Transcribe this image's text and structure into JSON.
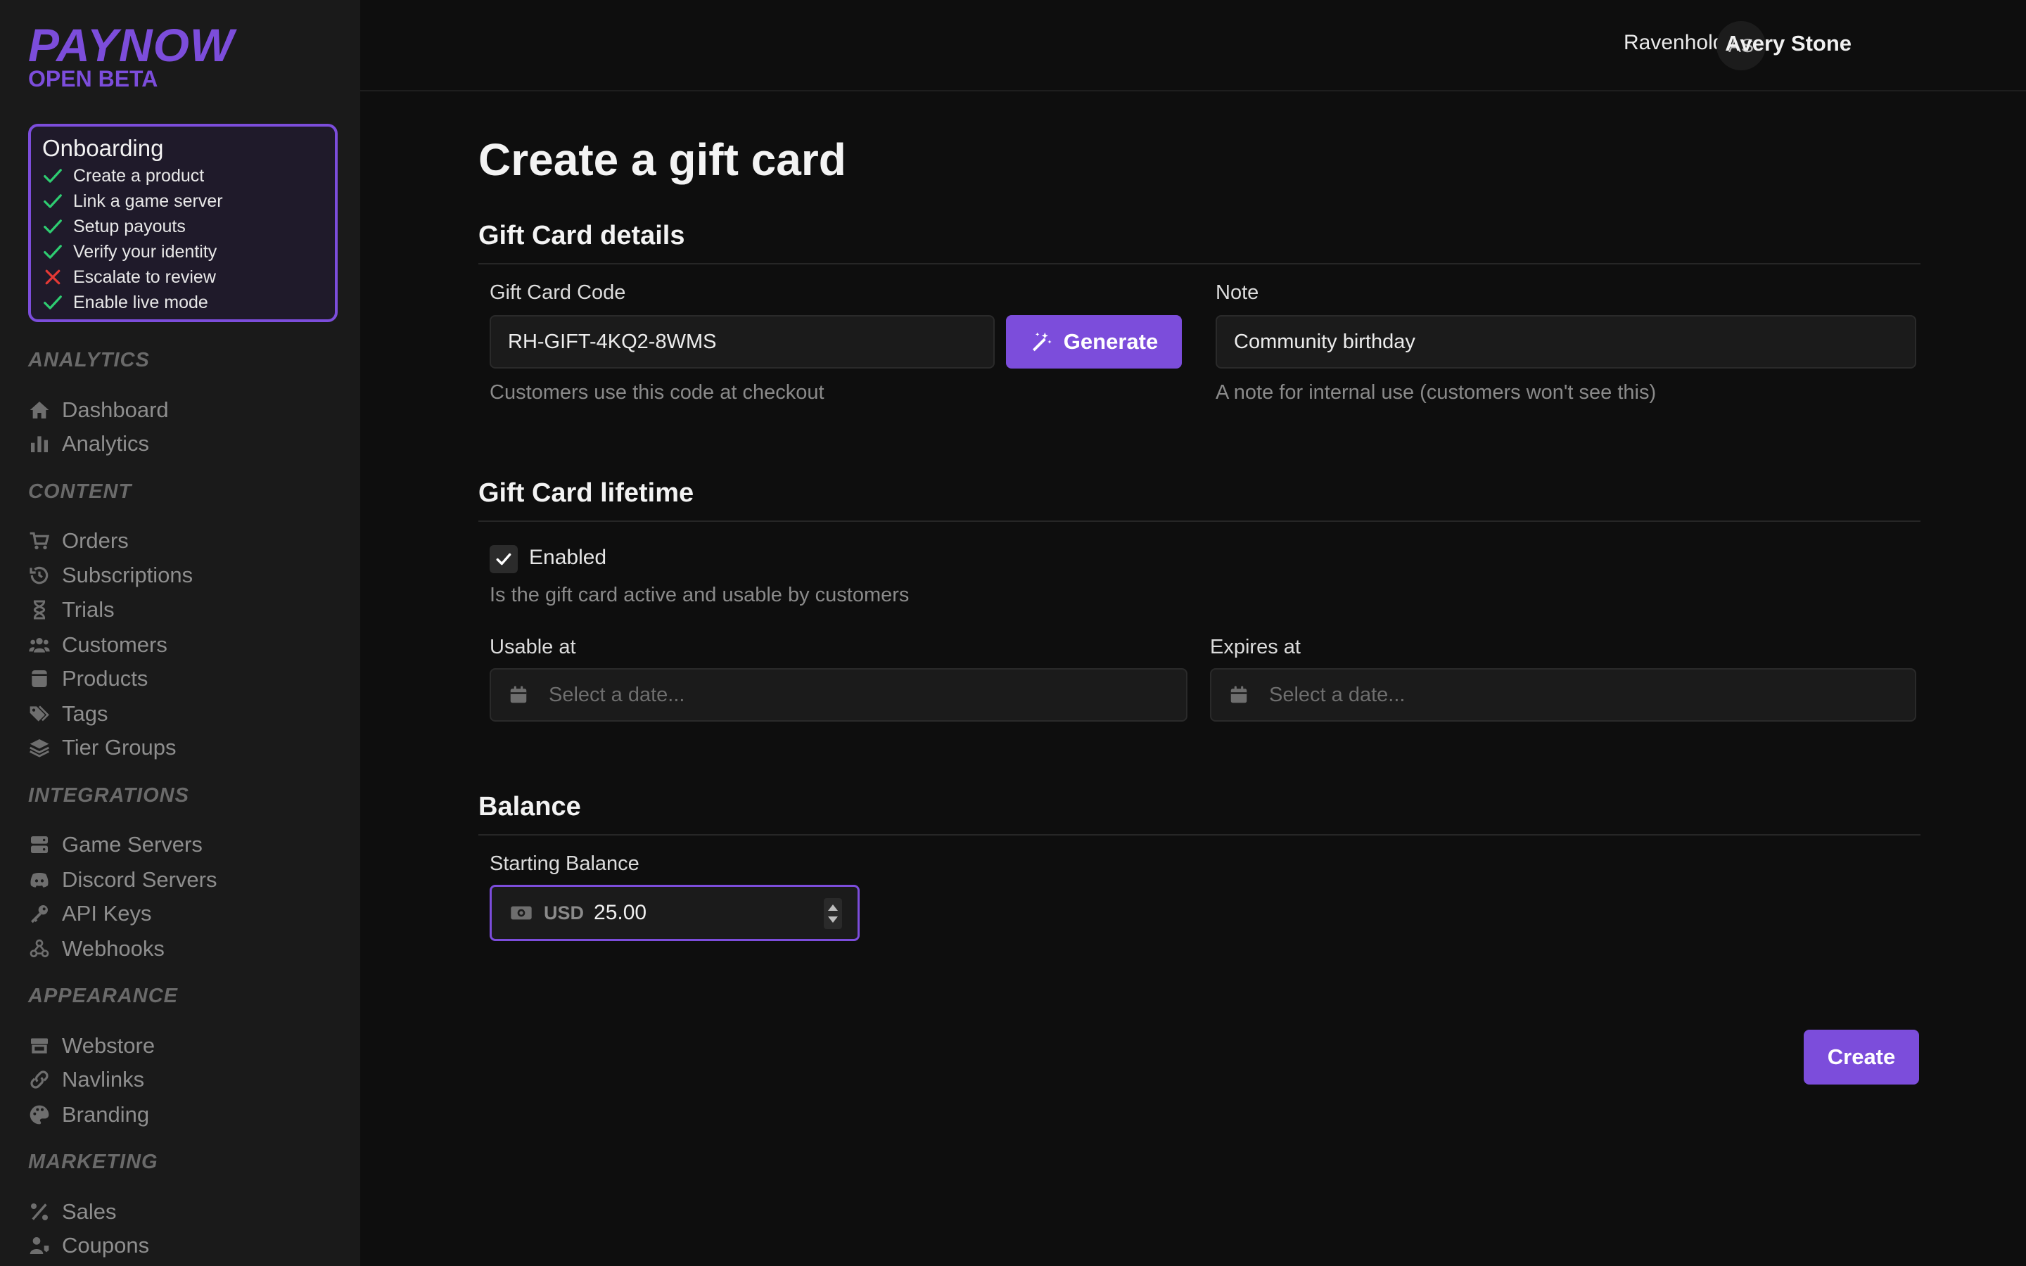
{
  "brand": {
    "title": "PAYNOW",
    "subtitle": "OPEN BETA"
  },
  "onboarding": {
    "title": "Onboarding",
    "items": [
      {
        "label": "Create a product",
        "status": "done"
      },
      {
        "label": "Link a game server",
        "status": "done"
      },
      {
        "label": "Setup payouts",
        "status": "done"
      },
      {
        "label": "Verify your identity",
        "status": "done"
      },
      {
        "label": "Escalate to review",
        "status": "failed"
      },
      {
        "label": "Enable live mode",
        "status": "done"
      }
    ]
  },
  "nav": {
    "analytics": {
      "title": "ANALYTICS",
      "items": [
        {
          "label": "Dashboard",
          "icon": "home-icon"
        },
        {
          "label": "Analytics",
          "icon": "bar-chart-icon"
        }
      ]
    },
    "content": {
      "title": "CONTENT",
      "items": [
        {
          "label": "Orders",
          "icon": "cart-icon"
        },
        {
          "label": "Subscriptions",
          "icon": "history-icon"
        },
        {
          "label": "Trials",
          "icon": "hourglass-icon"
        },
        {
          "label": "Customers",
          "icon": "users-icon"
        },
        {
          "label": "Products",
          "icon": "box-icon"
        },
        {
          "label": "Tags",
          "icon": "tags-icon"
        },
        {
          "label": "Tier Groups",
          "icon": "layers-icon"
        }
      ]
    },
    "integrations": {
      "title": "INTEGRATIONS",
      "items": [
        {
          "label": "Game Servers",
          "icon": "server-icon"
        },
        {
          "label": "Discord Servers",
          "icon": "discord-icon"
        },
        {
          "label": "API Keys",
          "icon": "key-icon"
        },
        {
          "label": "Webhooks",
          "icon": "webhook-icon"
        }
      ]
    },
    "appearance": {
      "title": "APPEARANCE",
      "items": [
        {
          "label": "Webstore",
          "icon": "store-icon"
        },
        {
          "label": "Navlinks",
          "icon": "link-icon"
        },
        {
          "label": "Branding",
          "icon": "palette-icon"
        }
      ]
    },
    "marketing": {
      "title": "MARKETING",
      "items": [
        {
          "label": "Sales",
          "icon": "percent-icon"
        },
        {
          "label": "Coupons",
          "icon": "user-tag-icon"
        }
      ]
    }
  },
  "header": {
    "store": "Ravenhold",
    "avatar_initials": "AS",
    "user_name": "Avery Stone"
  },
  "page": {
    "title": "Create a gift card",
    "details": {
      "title": "Gift Card details",
      "code_label": "Gift Card Code",
      "code_value": "RH-GIFT-4KQ2-8WMS",
      "code_help": "Customers use this code at checkout",
      "generate_label": "Generate",
      "note_label": "Note",
      "note_value": "Community birthday",
      "note_help": "A note for internal use (customers won't see this)"
    },
    "lifetime": {
      "title": "Gift Card lifetime",
      "enabled_label": "Enabled",
      "enabled_checked": true,
      "enabled_help": "Is the gift card active and usable by customers",
      "usable_label": "Usable at",
      "usable_placeholder": "Select a date...",
      "expires_label": "Expires at",
      "expires_placeholder": "Select a date..."
    },
    "balance": {
      "title": "Balance",
      "starting_label": "Starting Balance",
      "currency": "USD",
      "amount": "25.00"
    },
    "create_label": "Create"
  },
  "colors": {
    "accent": "#7c4ddb",
    "success": "#2ecc71",
    "danger": "#e53935",
    "background": "#0e0e0e",
    "sidebar": "#1a1a1a"
  }
}
